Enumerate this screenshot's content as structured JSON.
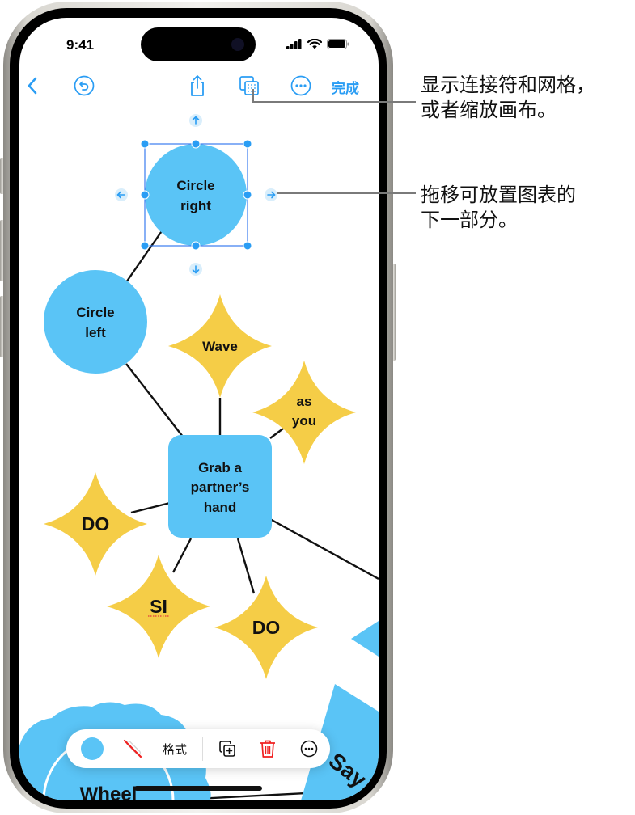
{
  "status_bar": {
    "time": "9:41"
  },
  "toolbar": {
    "back_icon": "chevron-left-icon",
    "undo_icon": "undo-icon",
    "share_icon": "share-icon",
    "view_options_icon": "grid-view-icon",
    "more_icon": "ellipsis-circle-icon",
    "done_label": "完成"
  },
  "canvas": {
    "nodes": [
      {
        "id": "circle-right",
        "shape": "circle",
        "label_lines": [
          "Circle",
          "right"
        ],
        "color": "#5ac4f6",
        "selected": true
      },
      {
        "id": "circle-left",
        "shape": "circle",
        "label_lines": [
          "Circle",
          "left"
        ],
        "color": "#5ac4f6"
      },
      {
        "id": "wave",
        "shape": "star",
        "label_lines": [
          "Wave"
        ],
        "color": "#f5cd47"
      },
      {
        "id": "as-you",
        "shape": "star",
        "label_lines": [
          "as",
          "you"
        ],
        "color": "#f5cd47"
      },
      {
        "id": "grab-hand",
        "shape": "rounded-rect",
        "label_lines": [
          "Grab a",
          "partner’s",
          "hand"
        ],
        "color": "#5ac4f6"
      },
      {
        "id": "do-left",
        "shape": "star",
        "label_lines": [
          "DO"
        ],
        "color": "#f5cd47"
      },
      {
        "id": "si",
        "shape": "star",
        "label_lines": [
          "SI"
        ],
        "color": "#f5cd47",
        "spellcheck_flag": true
      },
      {
        "id": "do-bottom",
        "shape": "star",
        "label_lines": [
          "DO"
        ],
        "color": "#f5cd47"
      },
      {
        "id": "wheel",
        "shape": "cloud",
        "label_lines": [
          "Wheel"
        ],
        "color": "#5ac4f6",
        "partially_visible": true
      },
      {
        "id": "say",
        "shape": "triangle",
        "label_lines": [
          "Say"
        ],
        "color": "#5ac4f6",
        "partially_visible": true
      }
    ],
    "selection_handles": [
      "arrow-up-icon",
      "arrow-down-icon",
      "arrow-left-icon",
      "arrow-right-icon"
    ]
  },
  "floating_toolbar": {
    "fill_color": "#5ac4f6",
    "stroke_icon": "no-stroke-icon",
    "format_label": "格式",
    "duplicate_icon": "duplicate-icon",
    "delete_icon": "trash-icon",
    "more_icon": "ellipsis-circle-icon"
  },
  "callouts": [
    {
      "lines": [
        "显示连接符和网格，",
        "或者缩放画布。"
      ]
    },
    {
      "lines": [
        "拖移可放置图表的",
        "下一部分。"
      ]
    }
  ]
}
